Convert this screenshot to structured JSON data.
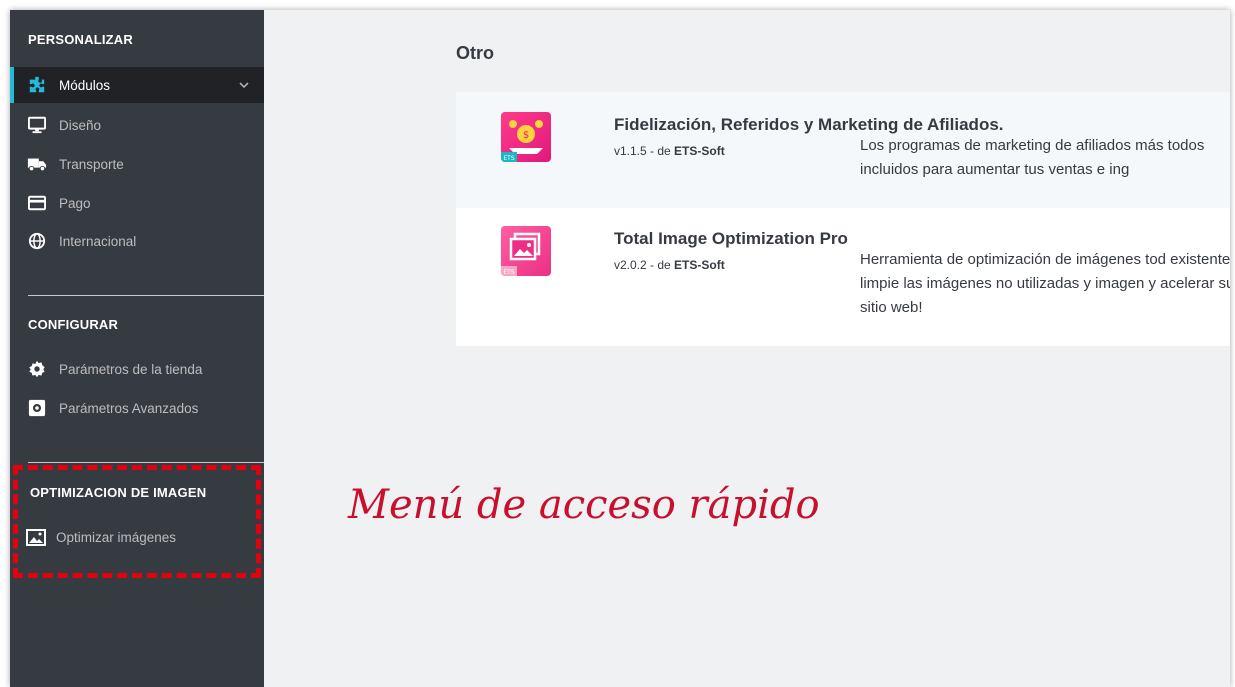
{
  "sidebar": {
    "personalizar": {
      "heading": "PERSONALIZAR",
      "items": [
        {
          "label": "Módulos",
          "icon": "puzzle-icon"
        },
        {
          "label": "Diseño",
          "icon": "monitor-icon"
        },
        {
          "label": "Transporte",
          "icon": "truck-icon"
        },
        {
          "label": "Pago",
          "icon": "credit-card-icon"
        },
        {
          "label": "Internacional",
          "icon": "globe-icon"
        }
      ]
    },
    "configurar": {
      "heading": "CONFIGURAR",
      "items": [
        {
          "label": "Parámetros de la tienda",
          "icon": "gear-icon"
        },
        {
          "label": "Parámetros Avanzados",
          "icon": "settings-box-icon"
        }
      ]
    },
    "optimizacion": {
      "heading": "OPTIMIZACION DE IMAGEN",
      "items": [
        {
          "label": "Optimizar imágenes",
          "icon": "image-icon"
        }
      ]
    }
  },
  "main": {
    "section_title": "Otro",
    "modules": [
      {
        "name": "Fidelización, Referidos y Marketing de Afiliados.",
        "version": "v1.1.5 - de ",
        "author": "ETS-Soft",
        "description": "Los programas de marketing de afiliados más todos incluidos para aumentar tus ventas e ing",
        "icon": "loyalty-module-icon",
        "badge": "ETS"
      },
      {
        "name": "Total Image Optimization Pro",
        "version": "v2.0.2 - de ",
        "author": "ETS-Soft",
        "description": "Herramienta de optimización de imágenes tod existentes, limpie las imágenes no utilizadas y imagen y acelerar su sitio web!",
        "icon": "image-optimization-module-icon",
        "badge": "ETS"
      }
    ]
  },
  "callout": "Menú de acceso rápido",
  "colors": {
    "sidebar": "#363a41",
    "active": "#202226",
    "accent": "#25b9d7",
    "callout": "#c8102e",
    "dashed": "#e3000f"
  }
}
